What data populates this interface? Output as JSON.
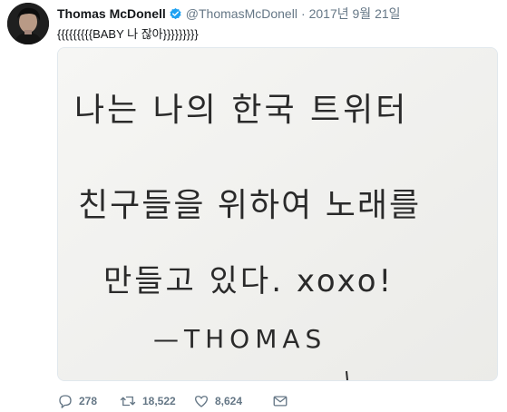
{
  "tweet": {
    "author_name": "Thomas McDonell",
    "handle": "@ThomasMcDonell",
    "separator": "·",
    "date": "2017년 9월 21일",
    "text": "{{{{{{{{{BABY 나 잖아}}}}}}}}}",
    "media": {
      "handwritten_lines": [
        "나는 나의 한국 트위터",
        "친구들을 위하여 노래를",
        "만들고 있다. xoxo!",
        "—THOMAS"
      ]
    },
    "actions": {
      "reply_count": "278",
      "retweet_count": "18,522",
      "like_count": "8,624"
    }
  },
  "colors": {
    "name": "#14171a",
    "muted": "#657786",
    "verified": "#1da1f2",
    "paper": "#f3f3f1",
    "ink": "#2a2a2a"
  }
}
